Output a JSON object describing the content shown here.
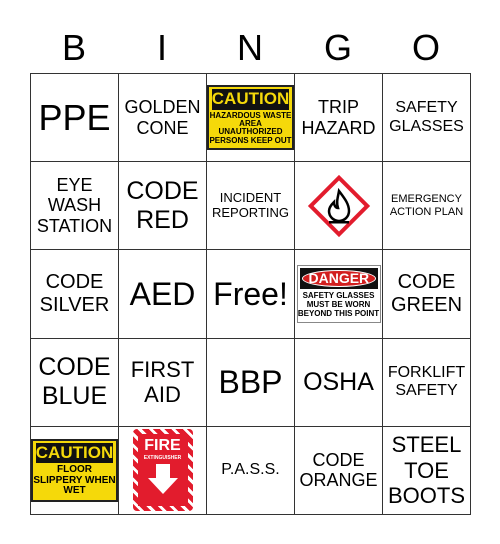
{
  "header": [
    "B",
    "I",
    "N",
    "G",
    "O"
  ],
  "cells": [
    "PPE",
    "GOLDEN CONE",
    {
      "sign": "caution",
      "title": "CAUTION",
      "text": "HAZARDOUS WASTE AREA UNAUTHORIZED PERSONS KEEP OUT"
    },
    "TRIP HAZARD",
    "SAFETY GLASSES",
    "EYE WASH STATION",
    "CODE RED",
    "INCIDENT REPORTING",
    {
      "sign": "ghs-flammable-pictogram"
    },
    "EMERGENCY ACTION PLAN",
    "CODE SILVER",
    "AED",
    "Free!",
    {
      "sign": "danger",
      "title": "DANGER",
      "text": "SAFETY GLASSES MUST BE WORN BEYOND THIS POINT"
    },
    "CODE GREEN",
    "CODE BLUE",
    "FIRST AID",
    "BBP",
    "OSHA",
    "FORKLIFT SAFETY",
    {
      "sign": "caution",
      "title": "CAUTION",
      "text": "FLOOR SLIPPERY WHEN WET"
    },
    {
      "sign": "fire-extinguisher",
      "title": "FIRE",
      "text": "EXTINGUISHER"
    },
    "P.A.S.S.",
    "CODE ORANGE",
    "STEEL TOE BOOTS"
  ],
  "colors": {
    "caution_yellow": "#f5d90a",
    "danger_red": "#d21f1f",
    "fire_red": "#e21c2d"
  }
}
